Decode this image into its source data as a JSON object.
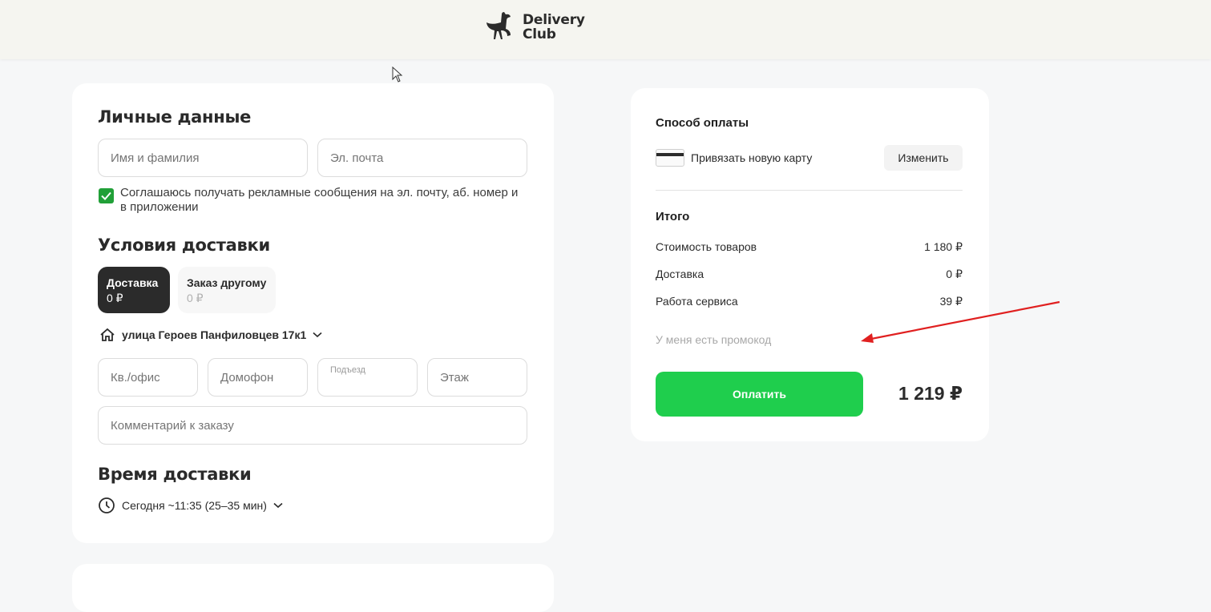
{
  "header": {
    "logo_line1": "Delivery",
    "logo_line2": "Club"
  },
  "personal": {
    "title": "Личные данные",
    "name_placeholder": "Имя и фамилия",
    "email_placeholder": "Эл. почта",
    "consent_checked": true,
    "consent_text": "Соглашаюсь получать рекламные сообщения на эл. почту, аб. номер и в приложении"
  },
  "delivery": {
    "title": "Условия доставки",
    "tabs": [
      {
        "label": "Доставка",
        "price": "0 ₽",
        "active": true
      },
      {
        "label": "Заказ другому",
        "price": "0 ₽",
        "active": false
      }
    ],
    "address": "улица Героев Панфиловцев 17к1",
    "fields": {
      "apartment": "Кв./офис",
      "intercom": "Домофон",
      "entrance": "Подъезд",
      "floor": "Этаж",
      "comment": "Комментарий к заказу"
    }
  },
  "delivery_time": {
    "title": "Время доставки",
    "value": "Сегодня ~11:35 (25–35 мин)"
  },
  "payment": {
    "title": "Способ оплаты",
    "card_label": "Привязать новую карту",
    "change_label": "Изменить"
  },
  "summary": {
    "title": "Итого",
    "rows": [
      {
        "label": "Стоимость товаров",
        "value": "1 180 ₽"
      },
      {
        "label": "Доставка",
        "value": "0 ₽"
      },
      {
        "label": "Работа сервиса",
        "value": "39 ₽"
      }
    ],
    "promo_label": "У меня есть промокод",
    "pay_label": "Оплатить",
    "total": "1 219 ₽"
  },
  "colors": {
    "accent_green": "#1fce4d",
    "checkbox_green": "#21a038",
    "annotation_red": "#e02020"
  }
}
